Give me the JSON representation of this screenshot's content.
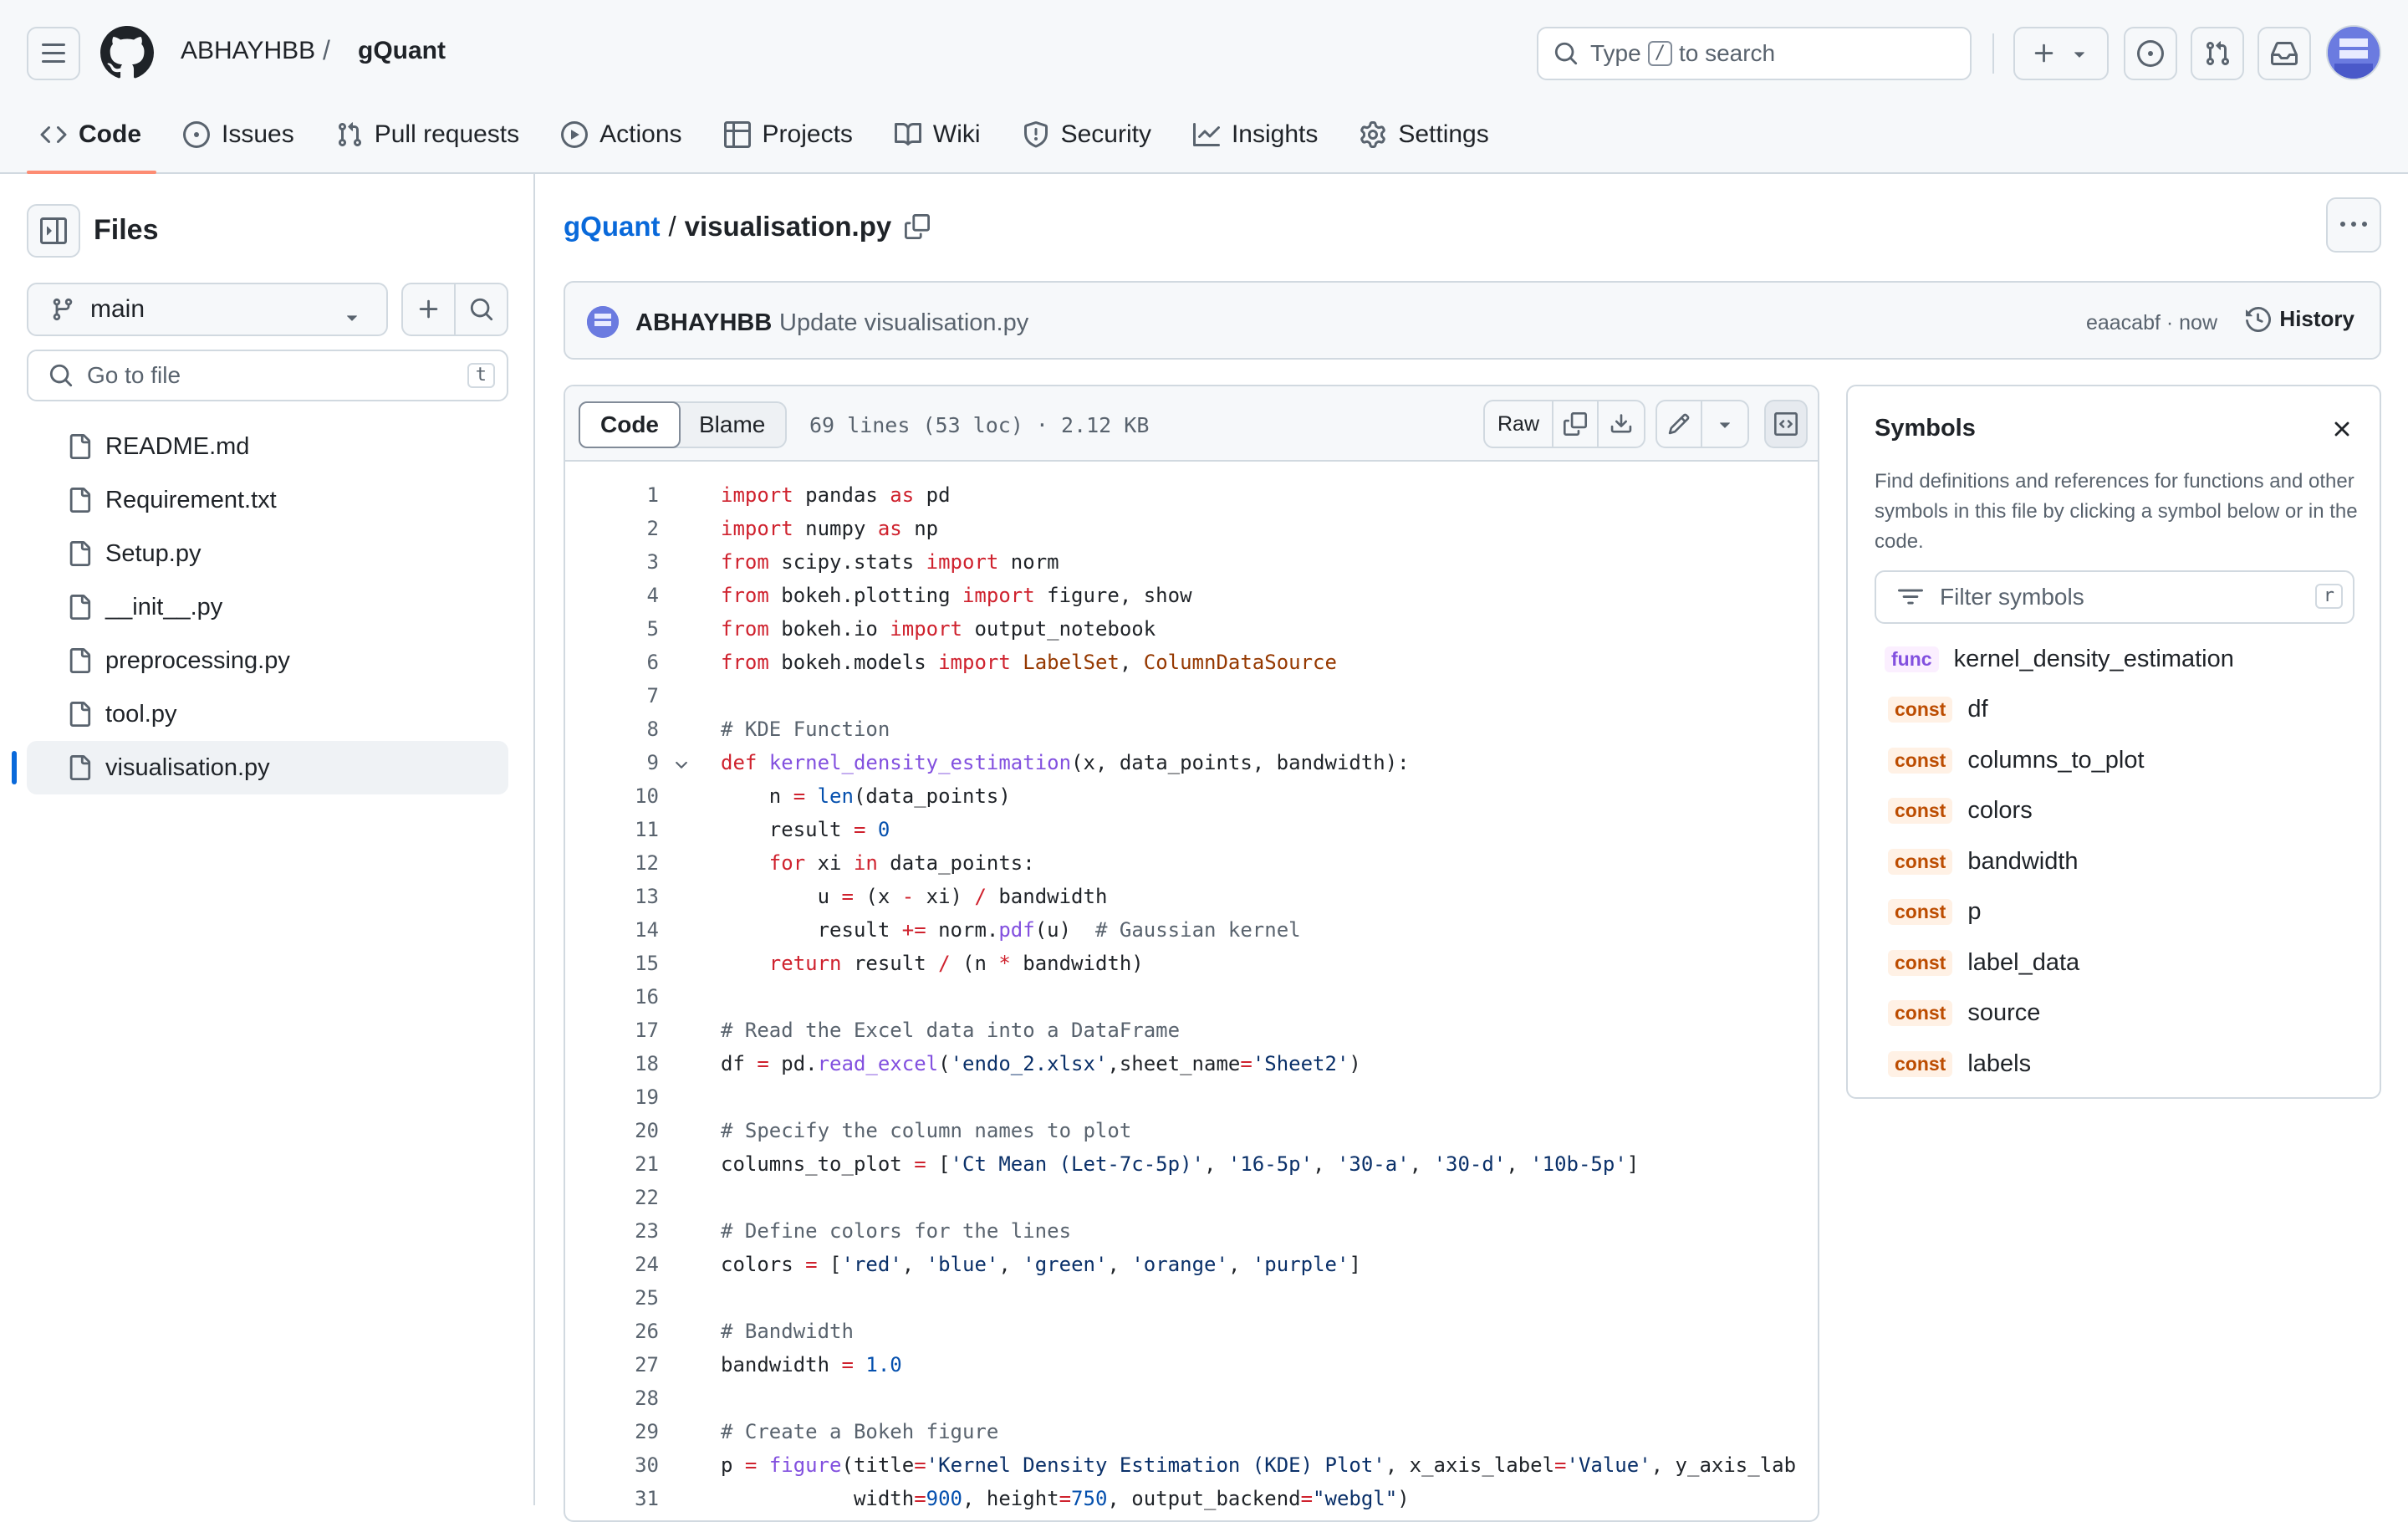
{
  "header": {
    "owner": "ABHAYHBB",
    "separator": "/",
    "repo": "gQuant",
    "search_prefix": "Type",
    "search_key": "/",
    "search_suffix": "to search"
  },
  "tabs": [
    {
      "label": "Code",
      "icon": "code-icon",
      "active": true
    },
    {
      "label": "Issues",
      "icon": "issue-icon"
    },
    {
      "label": "Pull requests",
      "icon": "pull-request-icon"
    },
    {
      "label": "Actions",
      "icon": "play-icon"
    },
    {
      "label": "Projects",
      "icon": "table-icon"
    },
    {
      "label": "Wiki",
      "icon": "book-icon"
    },
    {
      "label": "Security",
      "icon": "shield-icon"
    },
    {
      "label": "Insights",
      "icon": "graph-icon"
    },
    {
      "label": "Settings",
      "icon": "gear-icon"
    }
  ],
  "sidebar": {
    "title": "Files",
    "branch": "main",
    "goto_placeholder": "Go to file",
    "goto_key": "t",
    "files": [
      {
        "name": "README.md"
      },
      {
        "name": "Requirement.txt"
      },
      {
        "name": "Setup.py"
      },
      {
        "name": "__init__.py"
      },
      {
        "name": "preprocessing.py"
      },
      {
        "name": "tool.py"
      },
      {
        "name": "visualisation.py",
        "active": true
      }
    ]
  },
  "breadcrumb": {
    "repo": "gQuant",
    "separator": "/",
    "file": "visualisation.py"
  },
  "commit": {
    "author": "ABHAYHBB",
    "message": "Update visualisation.py",
    "meta": "eaacabf · now",
    "history_label": "History"
  },
  "code": {
    "tab_code": "Code",
    "tab_blame": "Blame",
    "info": "69 lines (53 loc) · 2.12 KB",
    "raw_label": "Raw",
    "lines": [
      "import pandas as pd",
      "import numpy as np",
      "from scipy.stats import norm",
      "from bokeh.plotting import figure, show",
      "from bokeh.io import output_notebook",
      "from bokeh.models import LabelSet, ColumnDataSource",
      "",
      "# KDE Function",
      "def kernel_density_estimation(x, data_points, bandwidth):",
      "    n = len(data_points)",
      "    result = 0",
      "    for xi in data_points:",
      "        u = (x - xi) / bandwidth",
      "        result += norm.pdf(u)  # Gaussian kernel",
      "    return result / (n * bandwidth)",
      "",
      "# Read the Excel data into a DataFrame",
      "df = pd.read_excel('endo_2.xlsx',sheet_name='Sheet2')",
      "",
      "# Specify the column names to plot",
      "columns_to_plot = ['Ct Mean (Let-7c-5p)', '16-5p', '30-a', '30-d', '10b-5p']",
      "",
      "# Define colors for the lines",
      "colors = ['red', 'blue', 'green', 'orange', 'purple']",
      "",
      "# Bandwidth",
      "bandwidth = 1.0",
      "",
      "# Create a Bokeh figure",
      "p = figure(title='Kernel Density Estimation (KDE) Plot', x_axis_label='Value', y_axis_lab",
      "           width=900, height=750, output_backend=\"webgl\")"
    ]
  },
  "symbols": {
    "title": "Symbols",
    "description": "Find definitions and references for functions and other symbols in this file by clicking a symbol below or in the code.",
    "filter_placeholder": "Filter symbols",
    "filter_key": "r",
    "items": [
      {
        "kind": "func",
        "name": "kernel_density_estimation"
      },
      {
        "kind": "const",
        "name": "df"
      },
      {
        "kind": "const",
        "name": "columns_to_plot"
      },
      {
        "kind": "const",
        "name": "colors"
      },
      {
        "kind": "const",
        "name": "bandwidth"
      },
      {
        "kind": "const",
        "name": "p"
      },
      {
        "kind": "const",
        "name": "label_data"
      },
      {
        "kind": "const",
        "name": "source"
      },
      {
        "kind": "const",
        "name": "labels"
      }
    ]
  },
  "colors": {
    "keyword": "#cf222e",
    "string": "#0a3069",
    "comment": "#59636e",
    "function": "#8250df",
    "builtin": "#0550ae",
    "class": "#953800",
    "accent": "#0969da",
    "tab_underline": "#fd8c73"
  }
}
